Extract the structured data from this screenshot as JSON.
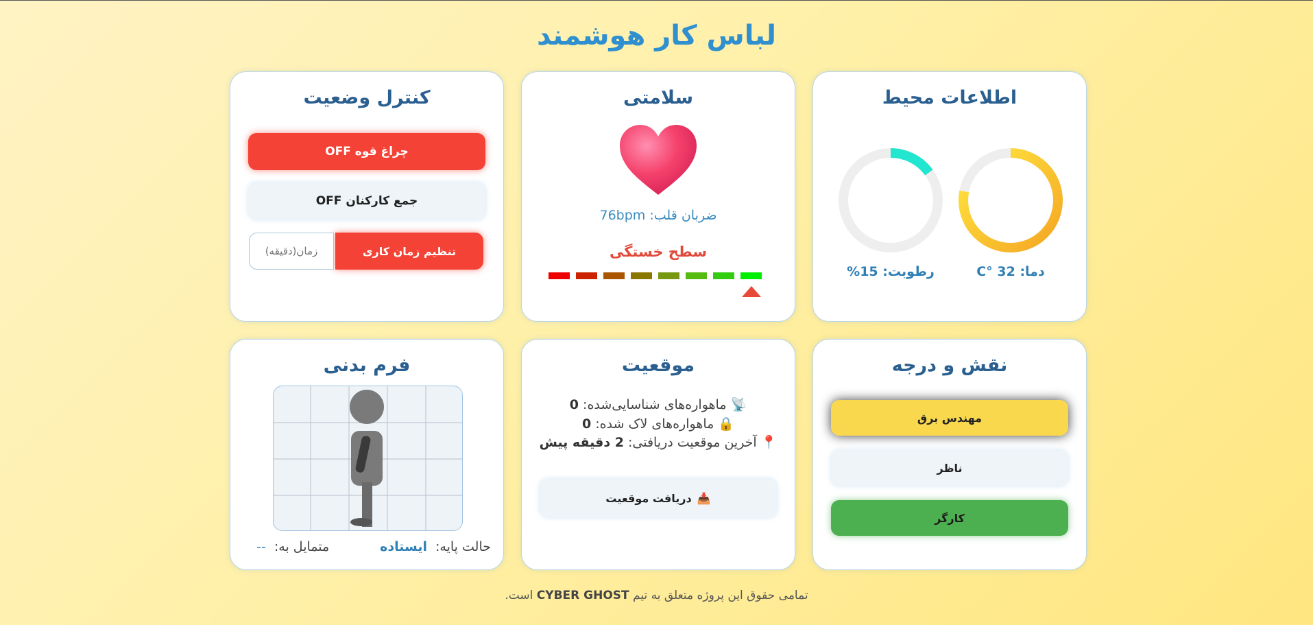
{
  "page": {
    "title": "لباس کار هوشمند"
  },
  "environment": {
    "title": "اطلاعات محیط",
    "temperature": {
      "label": "دما: 32 °C",
      "fraction": 0.78,
      "colors": [
        "#f5a623",
        "#ffe840"
      ]
    },
    "humidity": {
      "label": "رطوبت: 15%",
      "fraction": 0.15,
      "color": "#22e6d0"
    },
    "track_color": "#eeeeee"
  },
  "health": {
    "title": "سلامتی",
    "heart_rate": "ضربان قلب: 76bpm",
    "fatigue_title": "سطح خستگی",
    "fatigue_segments": [
      "#ee0000",
      "#cc2200",
      "#aa5500",
      "#8a7700",
      "#779911",
      "#55bb11",
      "#33cc11",
      "#00ee00"
    ],
    "fatigue_level_index": 7
  },
  "control": {
    "title": "کنترل وضعیت",
    "flashlight_label": "چراغ قوه OFF",
    "gather_label": "جمع کارکنان OFF",
    "work_time_label": "تنظیم زمان کاری",
    "time_placeholder": "زمان(دقیقه)"
  },
  "role": {
    "title": "نقش و درجه",
    "options": [
      "مهندس برق",
      "ناظر",
      "کارگر"
    ]
  },
  "location": {
    "title": "موقعیت",
    "satellites_detected_label": "ماهواره‌های شناسایی‌شده:",
    "satellites_detected_value": "0",
    "satellites_locked_label": "ماهواره‌های لاک شده:",
    "satellites_locked_value": "0",
    "last_fix_label": "آخرین موقعیت دریافتی:",
    "last_fix_value": "2 دقیقه پیش",
    "get_location_label": "دریافت موقعیت",
    "icons": [
      "satellite-icon",
      "lock-icon",
      "pin-icon",
      "inbox-icon"
    ]
  },
  "body": {
    "title": "فرم بدنی",
    "base_state_label": "حالت پایه:",
    "base_state_value": "ایستاده",
    "tilt_label": "متمایل به:",
    "tilt_value": "--"
  },
  "footer": {
    "prefix": "تمامی حقوق این پروژه متعلق به تیم",
    "team": "CYBER GHOST",
    "suffix": "است."
  }
}
